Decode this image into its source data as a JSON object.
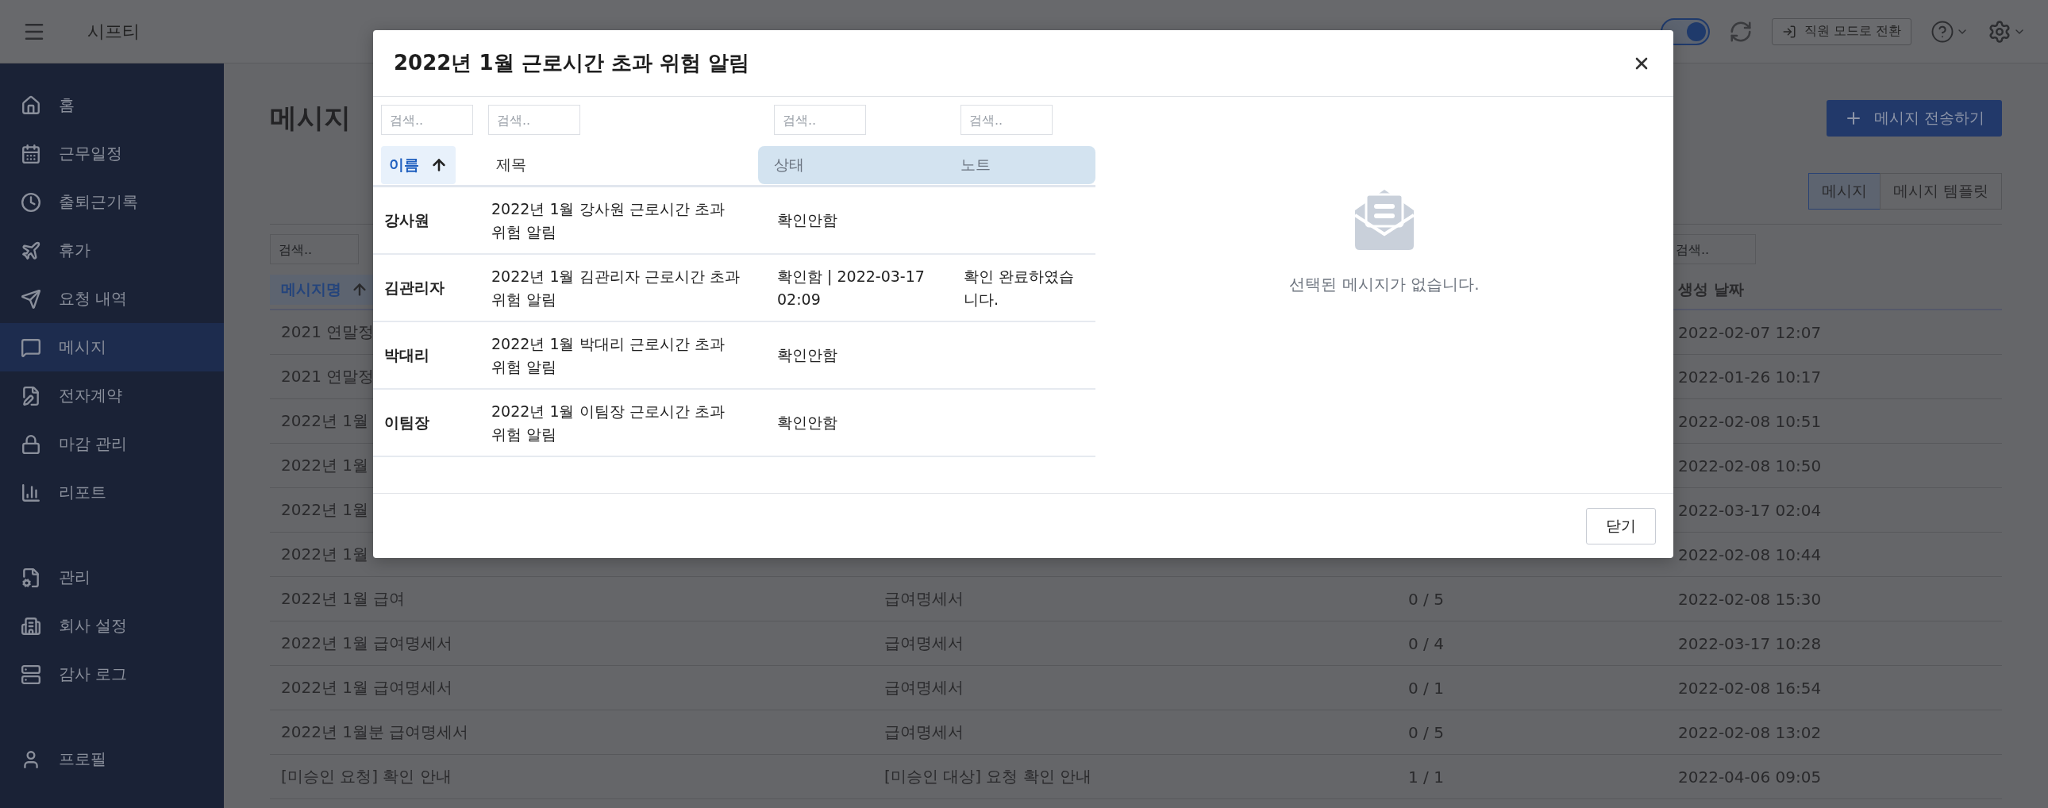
{
  "topbar": {
    "app_name": "시프티",
    "work_status": {
      "on": true
    },
    "switch_button": "직원 모드로 전환"
  },
  "sidebar": {
    "groups": [
      {
        "items": [
          {
            "label": "홈",
            "selected": false
          },
          {
            "label": "근무일정",
            "selected": false
          },
          {
            "label": "출퇴근기록",
            "selected": false
          },
          {
            "label": "휴가",
            "selected": false
          },
          {
            "label": "요청 내역",
            "selected": false
          },
          {
            "label": "메시지",
            "selected": true
          },
          {
            "label": "전자계약",
            "selected": false
          },
          {
            "label": "마감 관리",
            "selected": false
          },
          {
            "label": "리포트",
            "selected": false
          }
        ]
      },
      {
        "items": [
          {
            "label": "관리",
            "selected": false
          },
          {
            "label": "회사 설정",
            "selected": false
          },
          {
            "label": "감사 로그",
            "selected": false
          }
        ]
      },
      {
        "items": [
          {
            "label": "프로필",
            "selected": false
          }
        ]
      }
    ]
  },
  "page": {
    "title": "메시지",
    "send_button": "메시지 전송하기",
    "tabs": [
      {
        "label": "메시지",
        "selected": true
      },
      {
        "label": "메시지 템플릿",
        "selected": false
      }
    ],
    "table": {
      "name_column": {
        "label": "메시지명",
        "sorted": true,
        "placeholder": "검색.."
      },
      "date_column": {
        "label": "생성 날짜",
        "placeholder": "검색.."
      },
      "rows": [
        {
          "column_1": "2021 연말정",
          "column_4": "2022-02-07 12:07"
        },
        {
          "column_1": "2021 연말정",
          "column_4": "2022-01-26 10:17"
        },
        {
          "column_1": "2022년 1월",
          "column_4": "2022-02-08 10:51"
        },
        {
          "column_1": "2022년 1월",
          "column_4": "2022-02-08 10:50"
        },
        {
          "column_1": "2022년 1월",
          "column_4": "2022-03-17 02:04"
        },
        {
          "column_1": "2022년 1월",
          "column_4": "2022-02-08 10:44"
        },
        {
          "column_1": "2022년 1월 급여",
          "column_2": "급여명세서",
          "column_3": "0 / 5",
          "column_4": "2022-02-08 15:30"
        },
        {
          "column_1": "2022년 1월 급여명세서",
          "column_2": "급여명세서",
          "column_3": "0 / 4",
          "column_4": "2022-03-17 10:28"
        },
        {
          "column_1": "2022년 1월 급여명세서",
          "column_2": "급여명세서",
          "column_3": "0 / 1",
          "column_4": "2022-02-08 16:54"
        },
        {
          "column_1": "2022년 1월분 급여명세서",
          "column_2": "급여명세서",
          "column_3": "0 / 5",
          "column_4": "2022-02-08 13:02"
        },
        {
          "column_1": "[미승인 요청] 확인 안내",
          "column_2": "[미승인 대상] 요청 확인 안내",
          "column_3": "1 / 1",
          "column_4": "2022-04-06 09:05"
        }
      ]
    }
  },
  "modal": {
    "title": "2022년 1월 근로시간 초과 위험 알림",
    "columns": [
      {
        "label": "이름",
        "placeholder": "검색..",
        "sorted": true,
        "highlighted": false
      },
      {
        "label": "제목",
        "placeholder": "검색..",
        "sorted": false,
        "highlighted": false
      },
      {
        "label": "상태",
        "placeholder": "검색..",
        "sorted": false,
        "highlighted": true
      },
      {
        "label": "노트",
        "placeholder": "검색..",
        "sorted": false,
        "highlighted": true
      }
    ],
    "rows": [
      {
        "name": "강사원",
        "title": "2022년 1월 강사원 근로시간 초과 위험 알림",
        "status": "확인안함"
      },
      {
        "name": "김관리자",
        "title": "2022년 1월 김관리자 근로시간 초과 위험 알림",
        "status": "확인함 | 2022-03-17 02:09",
        "note": "확인 완료하였습니다."
      },
      {
        "name": "박대리",
        "title": "2022년 1월 박대리 근로시간 초과 위험 알림",
        "status": "확인안함"
      },
      {
        "name": "이팀장",
        "title": "2022년 1월 이팀장 근로시간 초과 위험 알림",
        "status": "확인안함"
      }
    ],
    "empty_message": "선택된 메시지가 없습니다.",
    "close_button": "닫기"
  }
}
